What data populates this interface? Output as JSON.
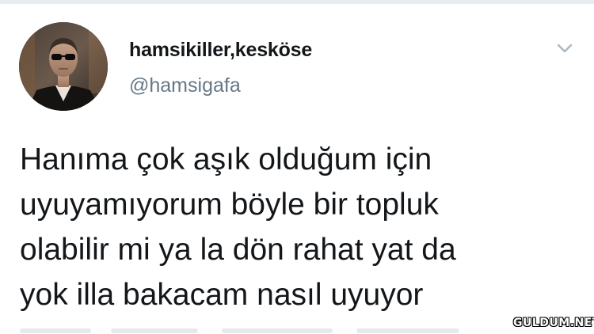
{
  "tweet": {
    "display_name": "hamsikiller,kesköse",
    "handle": "@hamsigafa",
    "text_lines": [
      "Hanıma çok aşık olduğum için",
      "uyuyamıyorum böyle bir topluk",
      "olabilir mi ya la dön rahat yat da",
      "yok illa bakacam nasıl uyuyor"
    ],
    "avatar_icon": "profile-photo-man-sunglasses",
    "menu_icon": "chevron-down-icon"
  },
  "watermark": {
    "text": "GULDUM.NET"
  },
  "colors": {
    "text_primary": "#14171a",
    "text_secondary": "#657786",
    "chevron": "#aab8c2",
    "border": "#e9ecef"
  }
}
